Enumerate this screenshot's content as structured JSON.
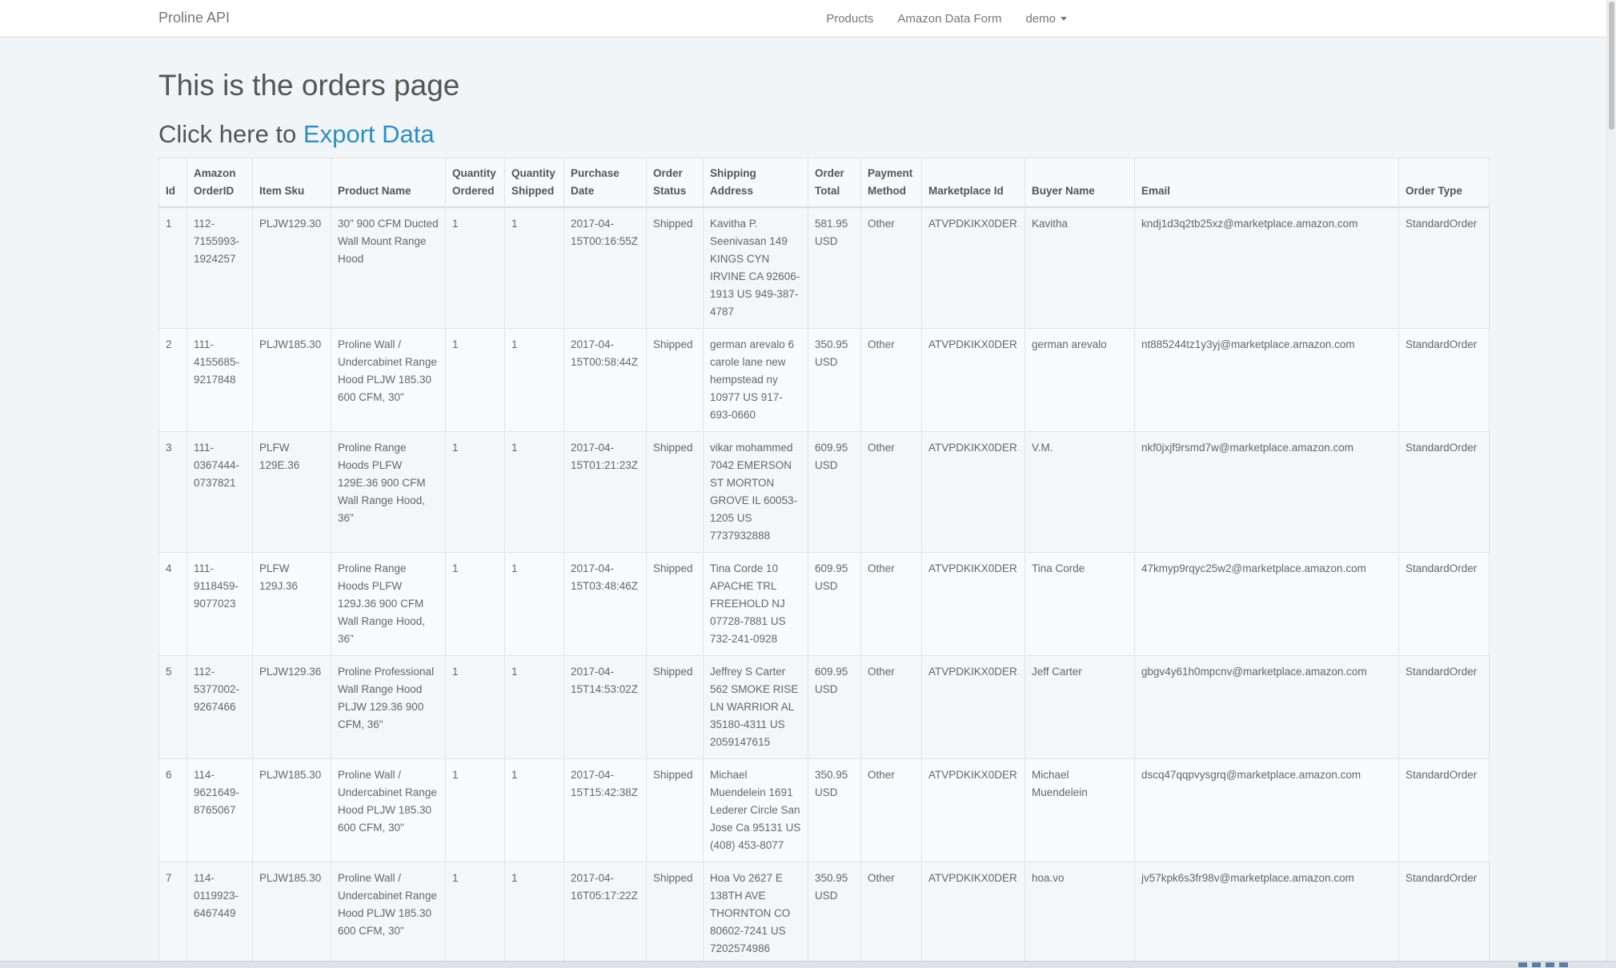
{
  "navbar": {
    "brand": "Proline API",
    "links": [
      "Products",
      "Amazon Data Form"
    ],
    "user_menu": "demo"
  },
  "page": {
    "title": "This is the orders page",
    "export_prefix": "Click here to",
    "export_link": "Export Data"
  },
  "table": {
    "headers": [
      "Id",
      "Amazon OrderID",
      "Item Sku",
      "Product Name",
      "Quantity Ordered",
      "Quantity Shipped",
      "Purchase Date",
      "Order Status",
      "Shipping Address",
      "Order Total",
      "Payment Method",
      "Marketplace Id",
      "Buyer Name",
      "Email",
      "Order Type"
    ],
    "rows": [
      [
        "1",
        "112-7155993-1924257",
        "PLJW129.30",
        "30\" 900 CFM Ducted Wall Mount Range Hood",
        "1",
        "1",
        "2017-04-15T00:16:55Z",
        "Shipped",
        "Kavitha P. Seenivasan 149 KINGS CYN IRVINE CA 92606-1913 US 949-387-4787",
        "581.95 USD",
        "Other",
        "ATVPDKIKX0DER",
        "Kavitha",
        "kndj1d3q2tb25xz@marketplace.amazon.com",
        "StandardOrder"
      ],
      [
        "2",
        "111-4155685-9217848",
        "PLJW185.30",
        "Proline Wall / Undercabinet Range Hood PLJW 185.30 600 CFM, 30\"",
        "1",
        "1",
        "2017-04-15T00:58:44Z",
        "Shipped",
        "german arevalo 6 carole lane new hempstead ny 10977 US 917-693-0660",
        "350.95 USD",
        "Other",
        "ATVPDKIKX0DER",
        "german arevalo",
        "nt885244tz1y3yj@marketplace.amazon.com",
        "StandardOrder"
      ],
      [
        "3",
        "111-0367444-0737821",
        "PLFW 129E.36",
        "Proline Range Hoods PLFW 129E.36 900 CFM Wall Range Hood, 36\"",
        "1",
        "1",
        "2017-04-15T01:21:23Z",
        "Shipped",
        "vikar mohammed 7042 EMERSON ST MORTON GROVE IL 60053-1205 US 7737932888",
        "609.95 USD",
        "Other",
        "ATVPDKIKX0DER",
        "V.M.",
        "nkf0jxjf9rsmd7w@marketplace.amazon.com",
        "StandardOrder"
      ],
      [
        "4",
        "111-9118459-9077023",
        "PLFW 129J.36",
        "Proline Range Hoods PLFW 129J.36 900 CFM Wall Range Hood, 36\"",
        "1",
        "1",
        "2017-04-15T03:48:46Z",
        "Shipped",
        "Tina Corde 10 APACHE TRL FREEHOLD NJ 07728-7881 US 732-241-0928",
        "609.95 USD",
        "Other",
        "ATVPDKIKX0DER",
        "Tina Corde",
        "47kmyp9rqyc25w2@marketplace.amazon.com",
        "StandardOrder"
      ],
      [
        "5",
        "112-5377002-9267466",
        "PLJW129.36",
        "Proline Professional Wall Range Hood PLJW 129.36 900 CFM, 36\"",
        "1",
        "1",
        "2017-04-15T14:53:02Z",
        "Shipped",
        "Jeffrey S Carter 562 SMOKE RISE LN WARRIOR AL 35180-4311 US 2059147615",
        "609.95 USD",
        "Other",
        "ATVPDKIKX0DER",
        "Jeff Carter",
        "gbgv4y61h0mpcnv@marketplace.amazon.com",
        "StandardOrder"
      ],
      [
        "6",
        "114-9621649-8765067",
        "PLJW185.30",
        "Proline Wall / Undercabinet Range Hood PLJW 185.30 600 CFM, 30\"",
        "1",
        "1",
        "2017-04-15T15:42:38Z",
        "Shipped",
        "Michael Muendelein 1691 Lederer Circle San Jose Ca 95131 US (408) 453-8077",
        "350.95 USD",
        "Other",
        "ATVPDKIKX0DER",
        "Michael Muendelein",
        "dscq47qqpvysgrq@marketplace.amazon.com",
        "StandardOrder"
      ],
      [
        "7",
        "114-0119923-6467449",
        "PLJW185.30",
        "Proline Wall / Undercabinet Range Hood PLJW 185.30 600 CFM, 30\"",
        "1",
        "1",
        "2017-04-16T05:17:22Z",
        "Shipped",
        "Hoa Vo 2627 E 138TH AVE THORNTON CO 80602-7241 US 7202574986",
        "350.95 USD",
        "Other",
        "ATVPDKIKX0DER",
        "hoa.vo",
        "jv57kpk6s3fr98v@marketplace.amazon.com",
        "StandardOrder"
      ]
    ]
  }
}
